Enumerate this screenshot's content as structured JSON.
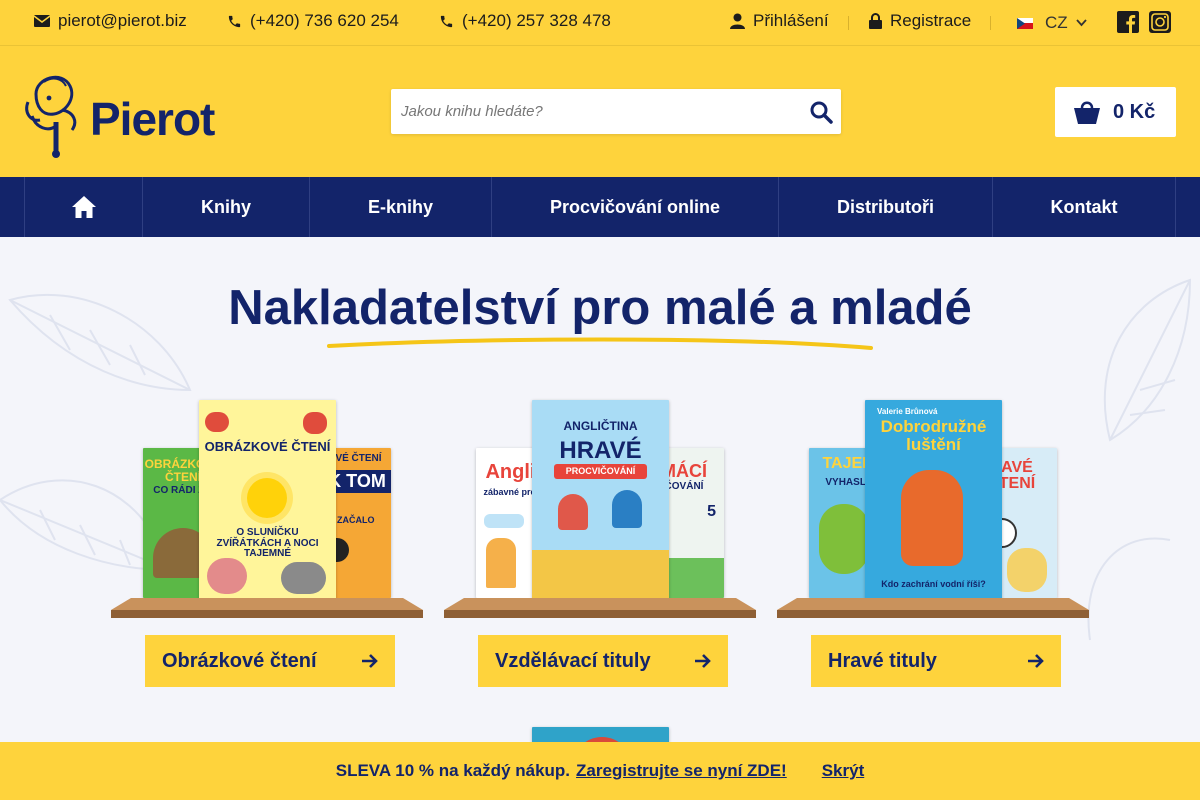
{
  "topbar": {
    "email": "pierot@pierot.biz",
    "phone1": "(+420) 736 620 254",
    "phone2": "(+420) 257 328 478",
    "login": "Přihlášení",
    "register": "Registrace",
    "language": "CZ",
    "icons": [
      "envelope-icon",
      "phone-icon",
      "user-icon",
      "lock-icon",
      "flag-cz-icon",
      "chevron-down-icon",
      "facebook-icon",
      "instagram-icon"
    ]
  },
  "header": {
    "logo_text": "Pierot",
    "search_placeholder": "Jakou knihu hledáte?",
    "cart_total": "0 Kč"
  },
  "nav": {
    "items": [
      {
        "label": "Knihy"
      },
      {
        "label": "E-knihy"
      },
      {
        "label": "Procvičování online"
      },
      {
        "label": "Distributoři"
      },
      {
        "label": "Kontakt"
      }
    ]
  },
  "hero": {
    "title": "Nakladatelství pro malé a mladé"
  },
  "categories": [
    {
      "label": "Obrázkové čtení",
      "books": {
        "left": "OBRÁZKOVÉ ČTENÍ",
        "left_sub": "CO RÁDI Z...",
        "center": "OBRÁZKOVÉ ČTENÍ",
        "center_sub": "O SLUNÍČKU ZVÍŘÁTKÁCH A NOCI TAJEMNÉ",
        "right": "KOVÉ ČTENÍ",
        "right_sub": "EK TOM",
        "right_sub2": "O ZAČALO"
      }
    },
    {
      "label": "Vzdělávací tituly",
      "books": {
        "left": "Anglič",
        "left_sub": "zábavné proc...",
        "center": "ANGLIČTINA",
        "center_sub": "HRAVÉ",
        "center_sub2": "PROCVIČOVÁNÍ",
        "right": "MÁCÍ",
        "right_sub": "ČOVÁNÍ",
        "right_num": "5"
      }
    },
    {
      "label": "Hravé tituly",
      "books": {
        "left": "TAJEM",
        "left_sub": "VYHASLÉ",
        "center_author": "Valerie Brůnová",
        "center": "Dobrodružné luštění",
        "center_sub": "Kdo zachrání vodní říši?",
        "right": "AVÉ",
        "right_sub": "TENÍ"
      }
    }
  ],
  "promo": {
    "text": "SLEVA 10 % na každý nákup.",
    "link": "Zaregistrujte se nyní ZDE!",
    "hide": "Skrýt"
  },
  "colors": {
    "yellow": "#fed33c",
    "navy": "#13246a",
    "background": "#f4f5fa"
  }
}
